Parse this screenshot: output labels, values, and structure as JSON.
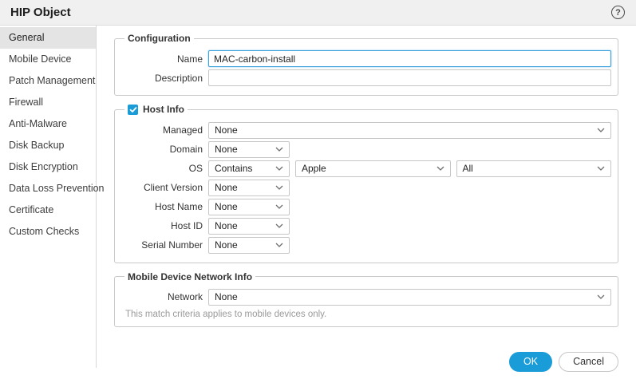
{
  "dialog": {
    "title": "HIP Object"
  },
  "icons": {
    "help": "?"
  },
  "sidebar": {
    "selected": "General",
    "items": [
      {
        "label": "General"
      },
      {
        "label": "Mobile Device"
      },
      {
        "label": "Patch Management"
      },
      {
        "label": "Firewall"
      },
      {
        "label": "Anti-Malware"
      },
      {
        "label": "Disk Backup"
      },
      {
        "label": "Disk Encryption"
      },
      {
        "label": "Data Loss Prevention"
      },
      {
        "label": "Certificate"
      },
      {
        "label": "Custom Checks"
      }
    ]
  },
  "configuration": {
    "legend": "Configuration",
    "name": {
      "label": "Name",
      "value": "MAC-carbon-install"
    },
    "description": {
      "label": "Description",
      "value": ""
    }
  },
  "host_info": {
    "legend": "Host Info",
    "checkbox_checked": true,
    "managed": {
      "label": "Managed",
      "value": "None"
    },
    "domain": {
      "label": "Domain",
      "value": "None"
    },
    "os": {
      "label": "OS",
      "match_value": "Contains",
      "vendor_value": "Apple",
      "version_value": "All"
    },
    "client_version": {
      "label": "Client Version",
      "value": "None"
    },
    "host_name": {
      "label": "Host Name",
      "value": "None"
    },
    "host_id": {
      "label": "Host ID",
      "value": "None"
    },
    "serial_number": {
      "label": "Serial Number",
      "value": "None"
    }
  },
  "mobile_network": {
    "legend": "Mobile Device Network Info",
    "network": {
      "label": "Network",
      "value": "None"
    },
    "note": "This match criteria applies to mobile devices only."
  },
  "footer": {
    "ok_label": "OK",
    "cancel_label": "Cancel"
  },
  "colors": {
    "accent_blue": "#1a9cd8",
    "focus_border": "#3aa0dc",
    "checkbox_blue": "#1a9cd8"
  }
}
